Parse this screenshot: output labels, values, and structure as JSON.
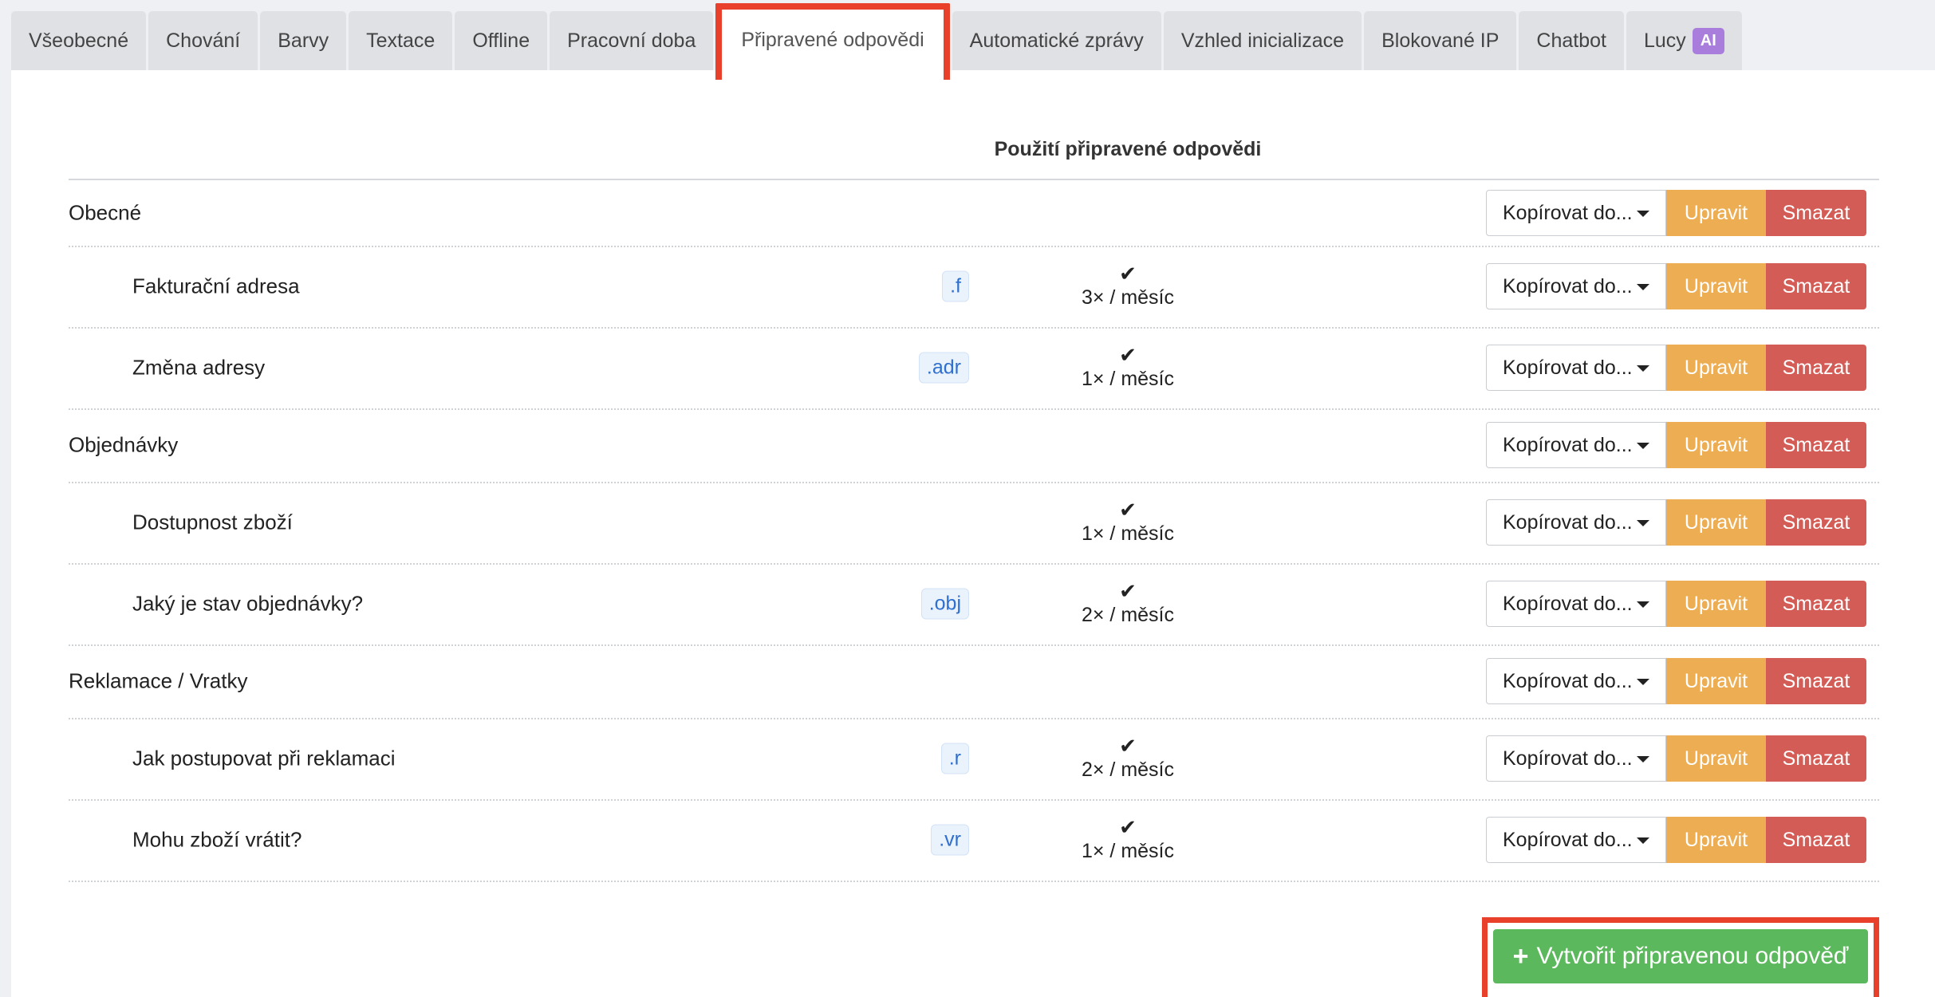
{
  "tabs": [
    {
      "label": "Všeobecné",
      "active": false
    },
    {
      "label": "Chování",
      "active": false
    },
    {
      "label": "Barvy",
      "active": false
    },
    {
      "label": "Textace",
      "active": false
    },
    {
      "label": "Offline",
      "active": false
    },
    {
      "label": "Pracovní doba",
      "active": false
    },
    {
      "label": "Připravené odpovědi",
      "active": true
    },
    {
      "label": "Automatické zprávy",
      "active": false
    },
    {
      "label": "Vzhled inicializace",
      "active": false
    },
    {
      "label": "Blokované IP",
      "active": false
    },
    {
      "label": "Chatbot",
      "active": false
    },
    {
      "label": "Lucy",
      "badge": "AI",
      "active": false
    }
  ],
  "table": {
    "usage_header": "Použití připravené odpovědi",
    "rows": [
      {
        "kind": "category",
        "label": "Obecné"
      },
      {
        "kind": "item",
        "label": "Fakturační adresa",
        "shortcut": ".f",
        "used": true,
        "usage": "3× / měsíc"
      },
      {
        "kind": "item",
        "label": "Změna adresy",
        "shortcut": ".adr",
        "used": true,
        "usage": "1× / měsíc"
      },
      {
        "kind": "category",
        "label": "Objednávky"
      },
      {
        "kind": "item",
        "label": "Dostupnost zboží",
        "shortcut": "",
        "used": true,
        "usage": "1× / měsíc"
      },
      {
        "kind": "item",
        "label": "Jaký je stav objednávky?",
        "shortcut": ".obj",
        "used": true,
        "usage": "2× / měsíc"
      },
      {
        "kind": "category",
        "label": "Reklamace / Vratky"
      },
      {
        "kind": "item",
        "label": "Jak postupovat při reklamaci",
        "shortcut": ".r",
        "used": true,
        "usage": "2× / měsíc"
      },
      {
        "kind": "item",
        "label": "Mohu zboží vrátit?",
        "shortcut": ".vr",
        "used": true,
        "usage": "1× / měsíc"
      }
    ]
  },
  "actions": {
    "copy_label": "Kopírovat do...",
    "edit_label": "Upravit",
    "delete_label": "Smazat"
  },
  "create_button": {
    "label": "Vytvořit připravenou odpověď",
    "icon": "plus-icon"
  },
  "colors": {
    "highlight": "#e8402a",
    "edit": "#edad52",
    "delete": "#d35d56",
    "create": "#5cb85c",
    "ai_badge": "#a87ddb"
  }
}
